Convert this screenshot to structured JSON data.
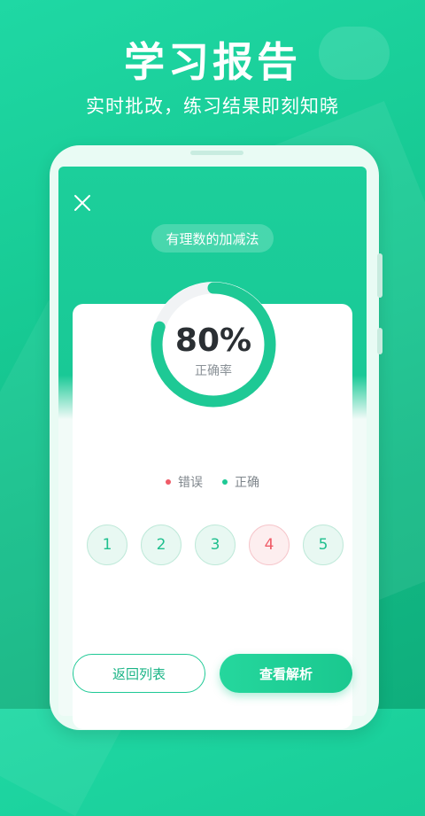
{
  "hero": {
    "title": "学习报告",
    "subtitle": "实时批改，练习结果即刻知晓"
  },
  "report": {
    "topic": "有理数的加减法",
    "score_text": "80%",
    "score_fraction": 0.8,
    "score_label": "正确率",
    "legend": {
      "wrong_label": "错误",
      "correct_label": "正确"
    },
    "answers": [
      {
        "number": "1",
        "status": "correct"
      },
      {
        "number": "2",
        "status": "correct"
      },
      {
        "number": "3",
        "status": "correct"
      },
      {
        "number": "4",
        "status": "wrong"
      },
      {
        "number": "5",
        "status": "correct"
      }
    ],
    "buttons": {
      "back_label": "返回列表",
      "analysis_label": "查看解析"
    }
  },
  "icons": {
    "close": "close-icon"
  },
  "colors": {
    "accent": "#1ec995",
    "wrong": "#ef5b67",
    "ring_track": "#f1f3f5"
  }
}
